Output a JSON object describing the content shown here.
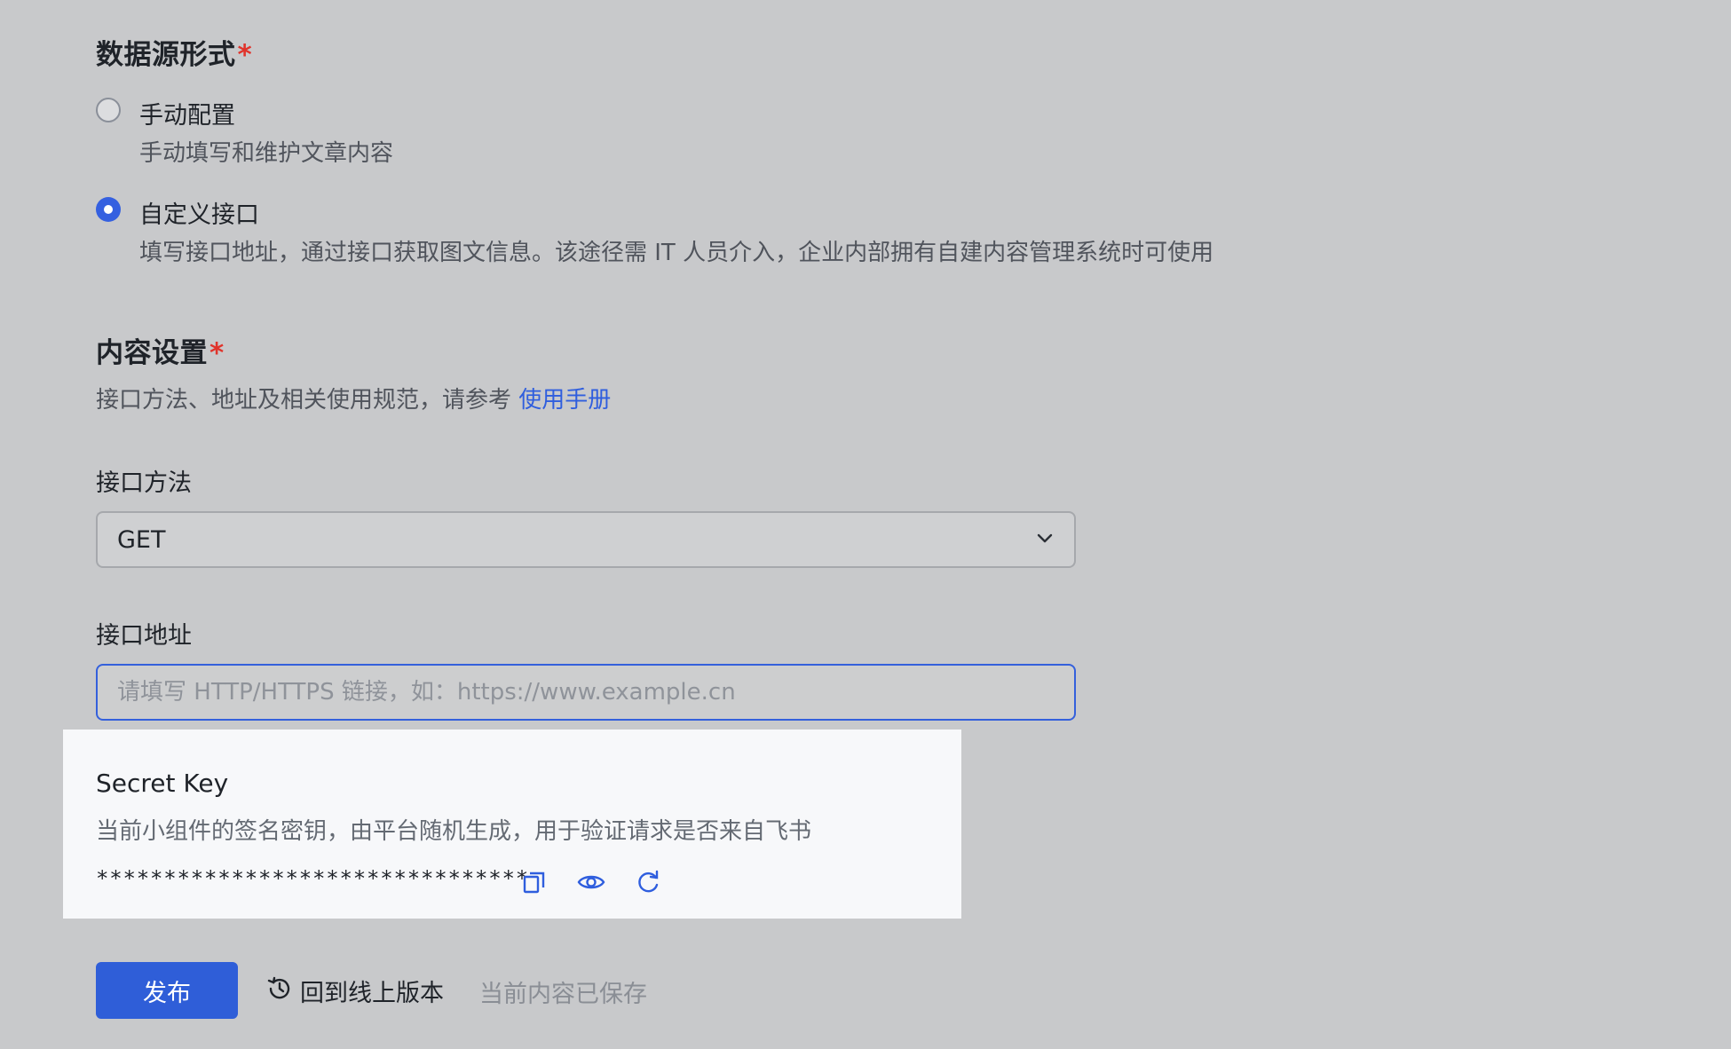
{
  "data_source": {
    "title": "数据源形式",
    "required_mark": "*",
    "options": [
      {
        "label": "手动配置",
        "description": "手动填写和维护文章内容",
        "checked": false
      },
      {
        "label": "自定义接口",
        "description": "填写接口地址，通过接口获取图文信息。该途径需 IT 人员介入，企业内部拥有自建内容管理系统时可使用",
        "checked": true
      }
    ]
  },
  "content_settings": {
    "title": "内容设置",
    "required_mark": "*",
    "description": "接口方法、地址及相关使用规范，请参考",
    "link_text": "使用手册"
  },
  "method": {
    "label": "接口方法",
    "selected": "GET"
  },
  "address": {
    "label": "接口地址",
    "value": "",
    "placeholder": "请填写 HTTP/HTTPS 链接，如：https://www.example.cn"
  },
  "secret": {
    "title": "Secret Key",
    "description": "当前小组件的签名密钥，由平台随机生成，用于验证请求是否来自飞书",
    "masked_value": "********************************",
    "icons": [
      "copy-icon",
      "eye-icon",
      "refresh-icon"
    ]
  },
  "footer": {
    "publish_label": "发布",
    "revert_label": "回到线上版本",
    "status_text": "当前内容已保存"
  },
  "colors": {
    "accent": "#2f5ed8",
    "required": "#e0342c",
    "link": "#2f5ede"
  }
}
